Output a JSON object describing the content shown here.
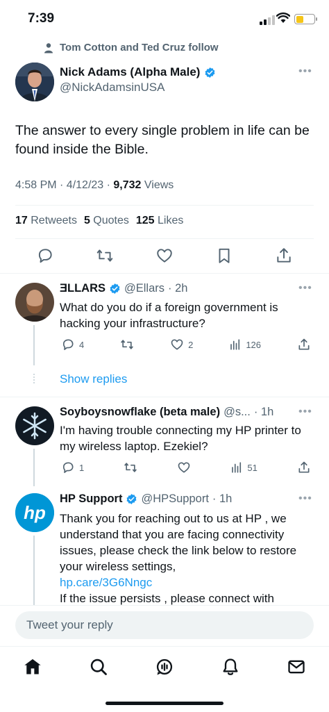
{
  "status": {
    "time": "7:39"
  },
  "social_context": "Tom Cotton and Ted Cruz follow",
  "main_tweet": {
    "name": "Nick Adams (Alpha Male)",
    "handle": "@NickAdamsinUSA",
    "text": "The answer to every single problem in life can be found inside the Bible.",
    "time": "4:58 PM · 4/12/23 · ",
    "views_count": "9,732",
    "views_label": " Views",
    "retweets_count": "17",
    "retweets_label": " Retweets",
    "quotes_count": "5",
    "quotes_label": " Quotes",
    "likes_count": "125",
    "likes_label": " Likes"
  },
  "replies": [
    {
      "name": "ƎLLARS",
      "handle": "@Ellars",
      "time": " · 2h",
      "text": "What do you do if a foreign government is hacking your infrastructure?",
      "reply_count": "4",
      "like_count": "2",
      "view_count": "126"
    },
    {
      "name": "Soyboysnowflake (beta male)",
      "handle": "@s...",
      "time": " · 1h",
      "text": "I'm having trouble connecting my HP printer to my wireless laptop.  Ezekiel?",
      "reply_count": "1",
      "like_count": "",
      "view_count": "51"
    },
    {
      "name": "HP Support",
      "handle": "@HPSupport",
      "time": " · 1h",
      "text": "Thank you for reaching out to us at HP , we understand that you are facing connectivity issues, please check the link below to restore your wireless settings,",
      "link": "hp.care/3G6Nngc",
      "text2": "If the issue persists , please connect with"
    }
  ],
  "show_replies": "Show replies",
  "compose_placeholder": "Tweet your reply",
  "colors": {
    "accent": "#1d9bf0",
    "secondary_text": "#536471",
    "hp_blue": "#0096d6"
  }
}
